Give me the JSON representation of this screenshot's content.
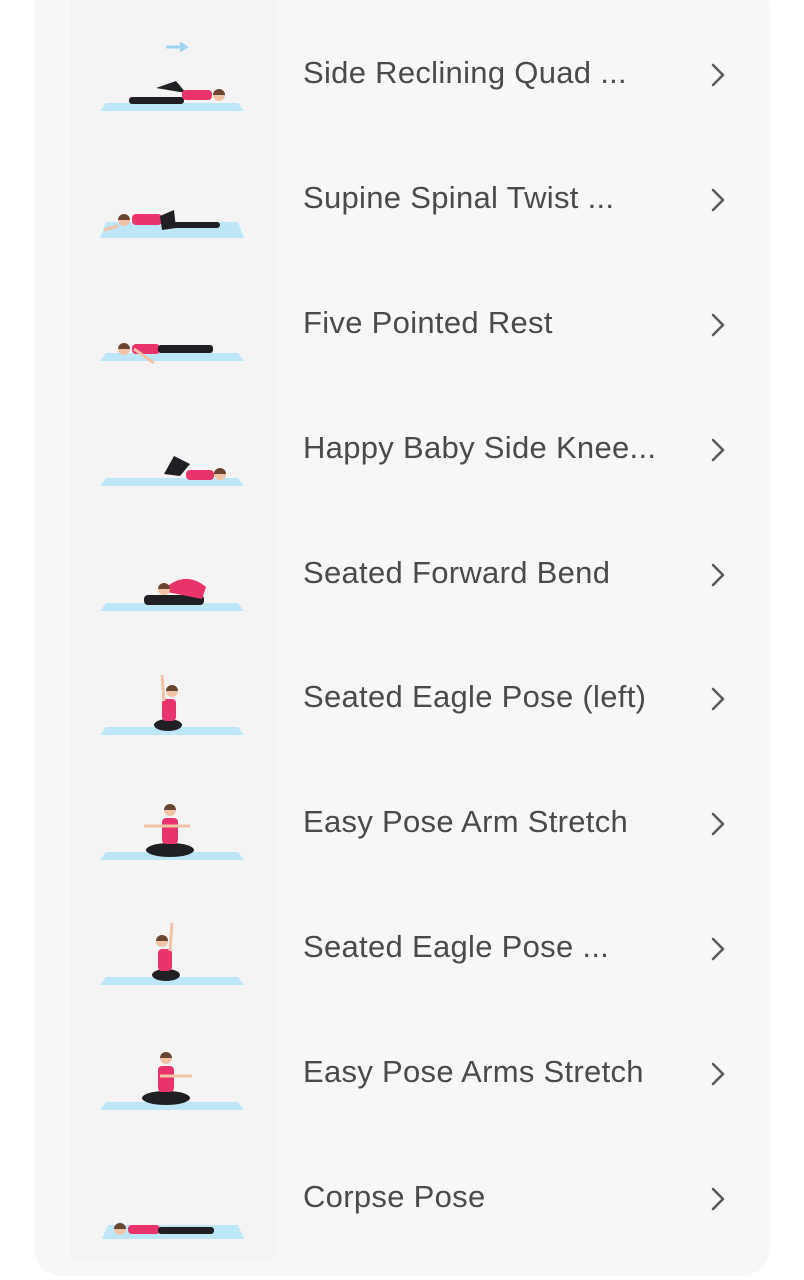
{
  "colors": {
    "mat": "#bde6f7",
    "shirt": "#e8336b",
    "pants": "#1f1f24",
    "skin": "#f1c3a6",
    "hair": "#6a4632",
    "text": "#4a4a4a",
    "chevron": "#5a5a5a",
    "arrow_hint": "#9fd4f0"
  },
  "exercises": [
    {
      "title": "Side Reclining Quad ...",
      "pose": "side-reclining-quad",
      "icon": "chevron-right-icon"
    },
    {
      "title": "Supine Spinal Twist ...",
      "pose": "supine-spinal-twist",
      "icon": "chevron-right-icon"
    },
    {
      "title": "Five Pointed Rest",
      "pose": "five-pointed-rest",
      "icon": "chevron-right-icon"
    },
    {
      "title": "Happy Baby Side Knee...",
      "pose": "happy-baby-side-knee",
      "icon": "chevron-right-icon"
    },
    {
      "title": "Seated Forward Bend",
      "pose": "seated-forward-bend",
      "icon": "chevron-right-icon"
    },
    {
      "title": "Seated Eagle Pose (left)",
      "pose": "seated-eagle-left",
      "icon": "chevron-right-icon"
    },
    {
      "title": "Easy Pose Arm Stretch",
      "pose": "easy-pose-arm-stretch",
      "icon": "chevron-right-icon"
    },
    {
      "title": "Seated Eagle Pose ...",
      "pose": "seated-eagle",
      "icon": "chevron-right-icon"
    },
    {
      "title": "Easy Pose Arms Stretch",
      "pose": "easy-pose-arms-stretch",
      "icon": "chevron-right-icon"
    },
    {
      "title": "Corpse Pose",
      "pose": "corpse-pose",
      "icon": "chevron-right-icon"
    }
  ]
}
